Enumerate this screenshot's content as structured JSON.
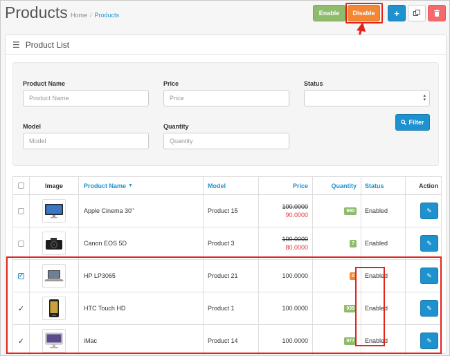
{
  "header": {
    "title": "Products",
    "breadcrumb": {
      "home": "Home",
      "separator": "/",
      "current": "Products"
    },
    "buttons": {
      "enable": "Enable",
      "disable": "Disable",
      "add": "+",
      "copy": "copy-icon",
      "delete": "trash-icon"
    }
  },
  "panel": {
    "title": "Product List"
  },
  "filter": {
    "product_name": {
      "label": "Product Name",
      "placeholder": "Product Name"
    },
    "price": {
      "label": "Price",
      "placeholder": "Price"
    },
    "status": {
      "label": "Status",
      "value": ""
    },
    "model": {
      "label": "Model",
      "placeholder": "Model"
    },
    "quantity": {
      "label": "Quantity",
      "placeholder": "Quantity"
    },
    "button": "Filter"
  },
  "table": {
    "columns": {
      "image": "Image",
      "name": "Product Name",
      "model": "Model",
      "price": "Price",
      "quantity": "Quantity",
      "status": "Status",
      "action": "Action"
    },
    "rows": [
      {
        "name": "Apple Cinema 30\"",
        "model": "Product 15",
        "price": "100.0000",
        "special": "90.0000",
        "quantity": "990",
        "qty_state": "success",
        "status": "Enabled",
        "checked": false,
        "thumb": "monitor"
      },
      {
        "name": "Canon EOS 5D",
        "model": "Product 3",
        "price": "100.0000",
        "special": "80.0000",
        "quantity": "7",
        "qty_state": "success",
        "status": "Enabled",
        "checked": false,
        "thumb": "camera"
      },
      {
        "name": "HP LP3065",
        "model": "Product 21",
        "price": "100.0000",
        "special": "",
        "quantity": "0",
        "qty_state": "warning",
        "status": "Enabled",
        "checked": true,
        "thumb": "laptop"
      },
      {
        "name": "HTC Touch HD",
        "model": "Product 1",
        "price": "100.0000",
        "special": "",
        "quantity": "939",
        "qty_state": "success",
        "status": "Enabled",
        "checked": true,
        "thumb": "phone"
      },
      {
        "name": "iMac",
        "model": "Product 14",
        "price": "100.0000",
        "special": "",
        "quantity": "977",
        "qty_state": "success",
        "status": "Enabled",
        "checked": true,
        "thumb": "imac"
      }
    ]
  },
  "colors": {
    "primary": "#1e91cf",
    "success": "#8fbb6c",
    "warning": "#f38733",
    "danger": "#f56b6b",
    "annotation": "#e2231a"
  }
}
